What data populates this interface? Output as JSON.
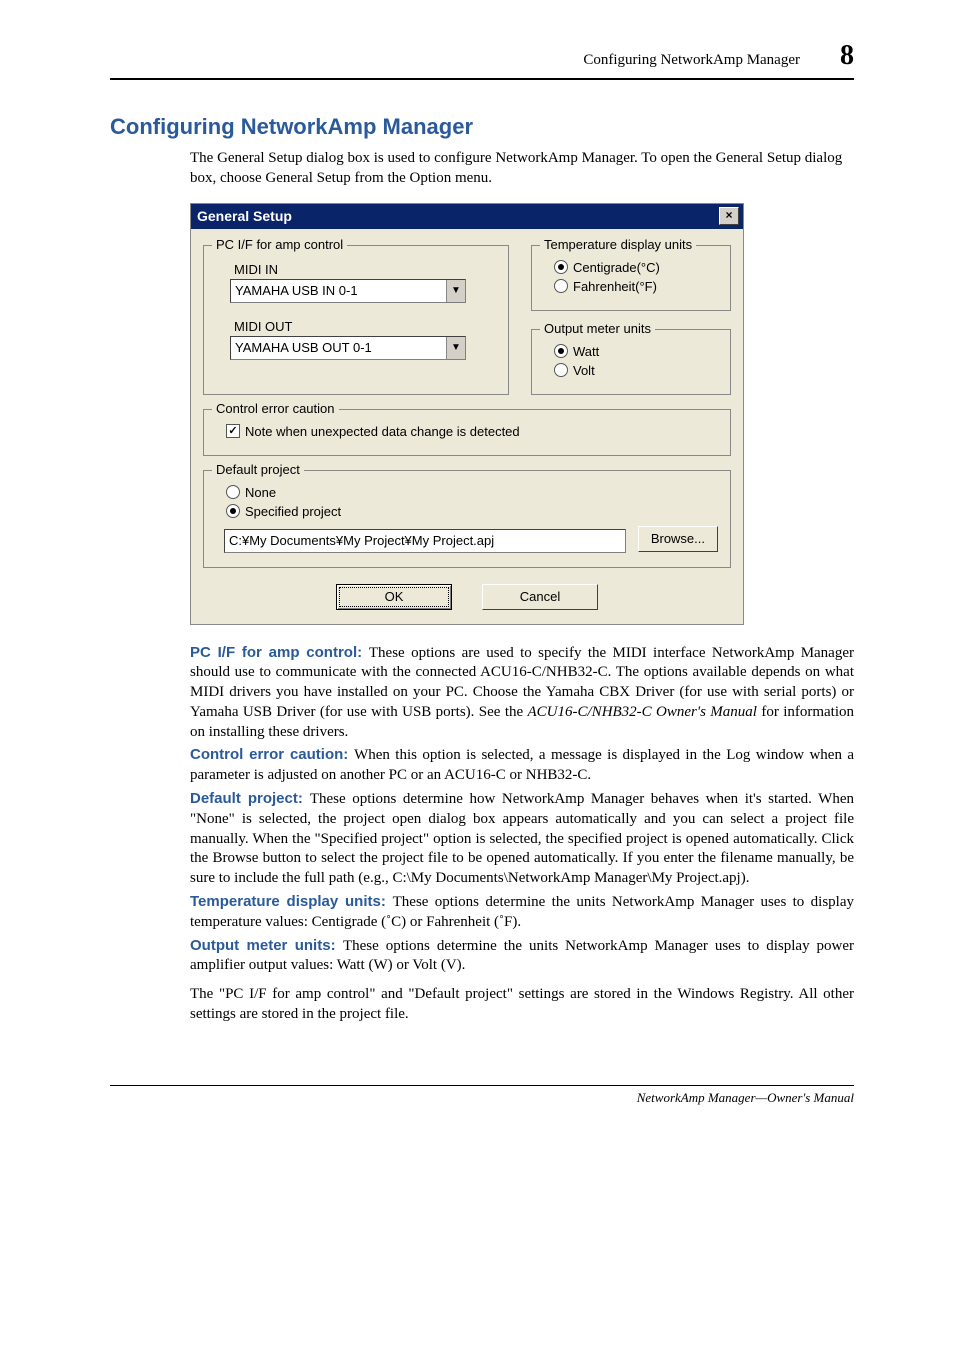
{
  "header": {
    "chapter": "Configuring NetworkAmp Manager",
    "page": "8"
  },
  "title": "Configuring NetworkAmp Manager",
  "intro": "The General Setup dialog box is used to configure NetworkAmp Manager. To open the General Setup dialog box, choose General Setup from the Option menu.",
  "dialog": {
    "title": "General Setup",
    "pcif_legend": "PC I/F for amp control",
    "midi_in_label": "MIDI IN",
    "midi_in_value": "YAMAHA USB IN 0-1",
    "midi_out_label": "MIDI OUT",
    "midi_out_value": "YAMAHA USB OUT 0-1",
    "temp_legend": "Temperature display units",
    "temp_c": "Centigrade(°C)",
    "temp_f": "Fahrenheit(°F)",
    "meter_legend": "Output meter units",
    "meter_w": "Watt",
    "meter_v": "Volt",
    "err_legend": "Control error caution",
    "err_check": "Note when unexpected data change is detected",
    "proj_legend": "Default project",
    "proj_none": "None",
    "proj_spec": "Specified project",
    "proj_path": "C:¥My Documents¥My Project¥My Project.apj",
    "browse": "Browse...",
    "ok": "OK",
    "cancel": "Cancel"
  },
  "paras": {
    "pcif_head": "PC I/F for amp control: ",
    "pcif_body_a": "These options are used to specify the MIDI interface NetworkAmp Manager should use to communicate with the connected ACU16-C/NHB32-C. The options available depends on what MIDI drivers you have installed on your PC. Choose the Yamaha CBX Driver (for use with serial ports) or Yamaha USB Driver (for use with USB ports). See the ",
    "pcif_em": "ACU16-C/NHB32-C Owner's Manual",
    "pcif_body_b": " for information on installing these drivers.",
    "err_head": "Control error caution: ",
    "err_body": "When this option is selected, a message is displayed in the Log window when a parameter is adjusted on another PC or an ACU16-C or NHB32-C.",
    "proj_head": "Default project: ",
    "proj_body": "These options determine how NetworkAmp Manager behaves when it's started. When \"None\" is selected, the project open dialog box appears automatically and you can select a project file manually. When the \"Specified project\" option is selected, the specified project is opened automatically. Click the Browse button to select the project file to be opened automatically. If you enter the filename manually, be sure to include the full path (e.g., C:\\My Documents\\NetworkAmp Manager\\My Project.apj).",
    "temp_head": "Temperature display units: ",
    "temp_body": "These options determine the units NetworkAmp Manager uses to display temperature values: Centigrade (˚C) or Fahrenheit (˚F).",
    "meter_head": "Output meter units: ",
    "meter_body": "These options determine the units NetworkAmp Manager uses to display power amplifier output values: Watt (W) or Volt (V).",
    "note_body": "The \"PC I/F for amp control\" and \"Default project\" settings are stored in the Windows Registry. All other settings are stored in the project file."
  },
  "footer": "NetworkAmp Manager—Owner's Manual"
}
